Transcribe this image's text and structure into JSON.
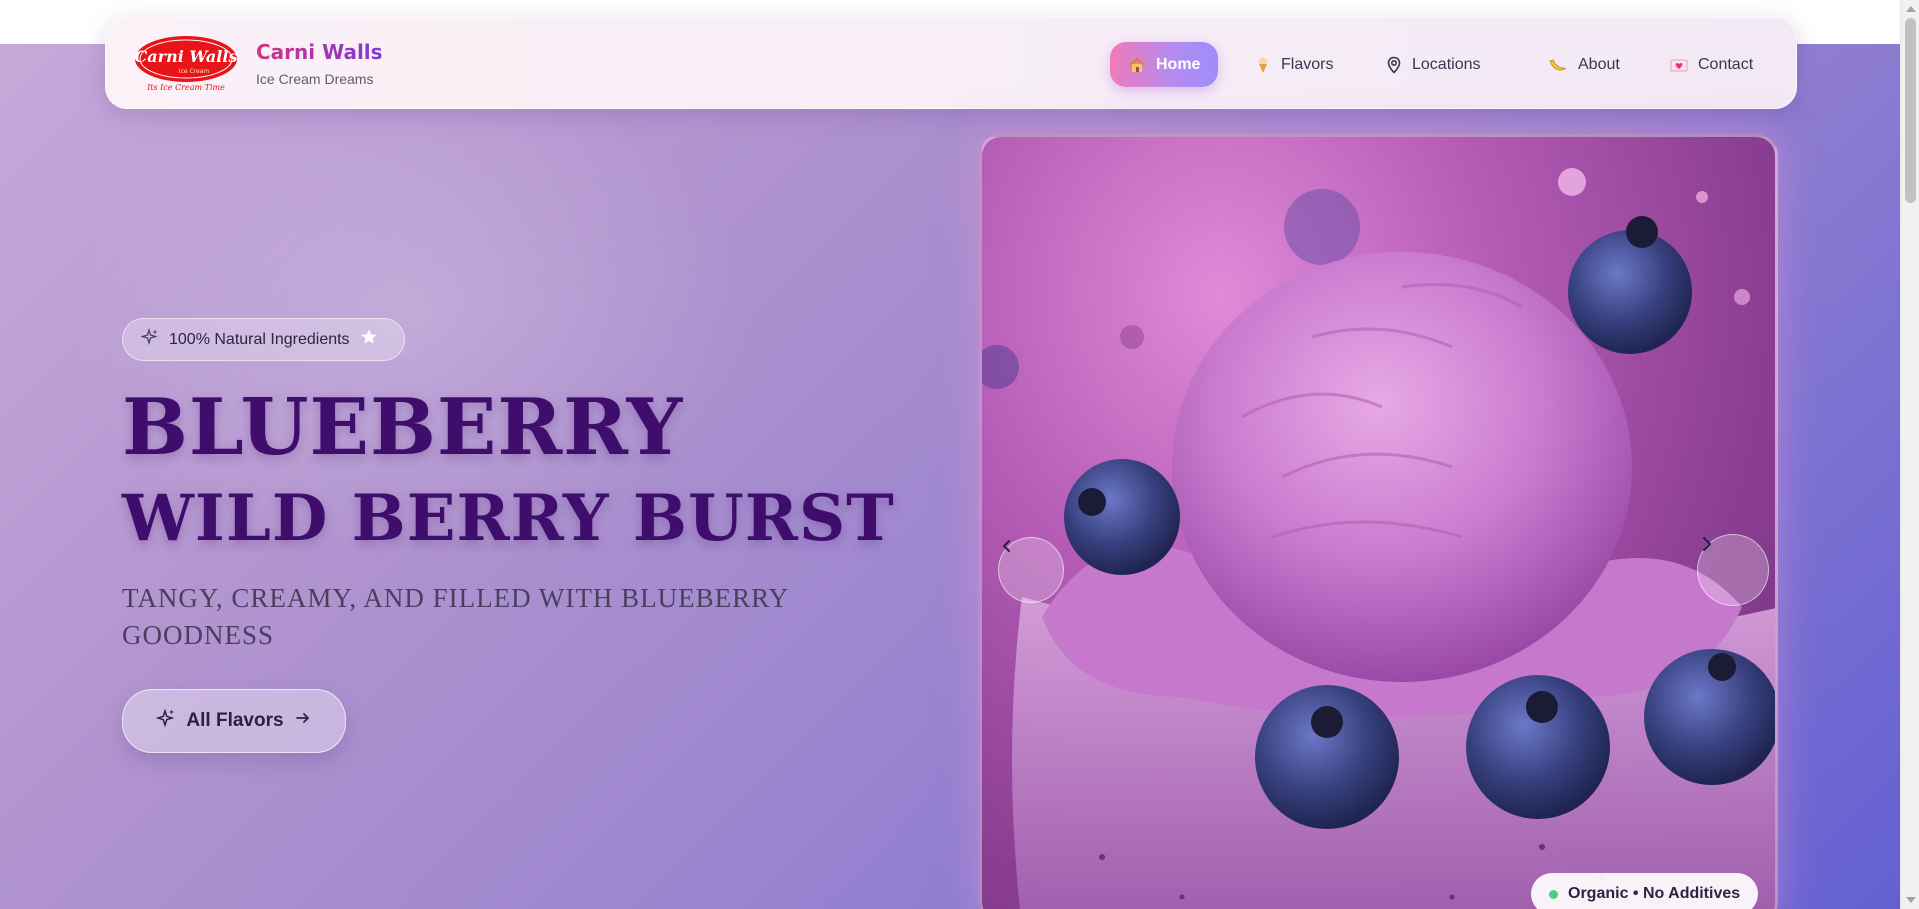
{
  "brand": {
    "logo_text": "Carni Walls",
    "logo_sub": "Ice Cream",
    "logo_tagline": "Ice Cream Time",
    "name": "Carni Walls",
    "tagline": "Ice Cream Dreams"
  },
  "nav": {
    "items": [
      {
        "label": "Home",
        "icon": "house-icon",
        "active": true
      },
      {
        "label": "Flavors",
        "icon": "ice-cream-cone-icon",
        "active": false
      },
      {
        "label": "Locations",
        "icon": "map-pin-icon",
        "active": false
      },
      {
        "label": "About",
        "icon": "banana-icon",
        "active": false
      },
      {
        "label": "Contact",
        "icon": "heart-letter-icon",
        "active": false
      }
    ]
  },
  "hero": {
    "badge": "100% Natural Ingredients",
    "title_line1": "BLUEBERRY",
    "title_line2": "WILD BERRY BURST",
    "description": "TANGY, CREAMY, AND FILLED WITH BLUEBERRY GOODNESS",
    "cta_label": "All Flavors"
  },
  "carousel": {
    "image_subject": "blueberry-ice-cream-bowl",
    "badge": "Organic • No Additives"
  },
  "colors": {
    "title": "#3f0d6b",
    "brand_gradient_start": "#d63384",
    "brand_gradient_end": "#7a3bd6",
    "active_nav_start": "#f07ab8",
    "active_nav_end": "#9d8df7",
    "organic_dot": "#4cd07d"
  }
}
